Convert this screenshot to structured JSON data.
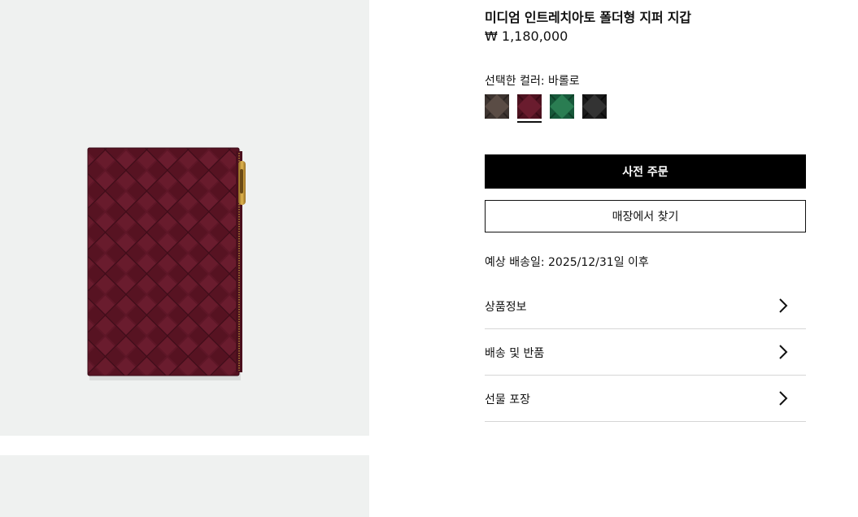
{
  "product": {
    "title": "미디엄 인트레치아토 폴더형 지퍼 지갑",
    "price": "₩ 1,180,000",
    "selected_color": "선택한 컬러: 바롤로",
    "image": {
      "alt": "wallet-image",
      "colors": {
        "background": "#eff1f0",
        "leather": "#5e1627",
        "zipper": "#c99a3a"
      }
    }
  },
  "swatches": [
    {
      "name": "swatch-brown",
      "color": "#4a3f39",
      "selected": false
    },
    {
      "name": "swatch-barolo",
      "color": "#5e1a27",
      "selected": true
    },
    {
      "name": "swatch-green",
      "color": "#1f6b45",
      "selected": false
    },
    {
      "name": "swatch-black",
      "color": "#222222",
      "selected": false
    }
  ],
  "buttons": {
    "preorder": "사전 주문",
    "find_in_store": "매장에서 찾기"
  },
  "delivery": "예상 배송일: 2025/12/31일 이후",
  "accordion": [
    {
      "label": "상품정보",
      "icon": "chevron-right-icon"
    },
    {
      "label": "배송 및 반품",
      "icon": "chevron-right-icon"
    },
    {
      "label": "선물 포장",
      "icon": "chevron-right-icon"
    }
  ]
}
